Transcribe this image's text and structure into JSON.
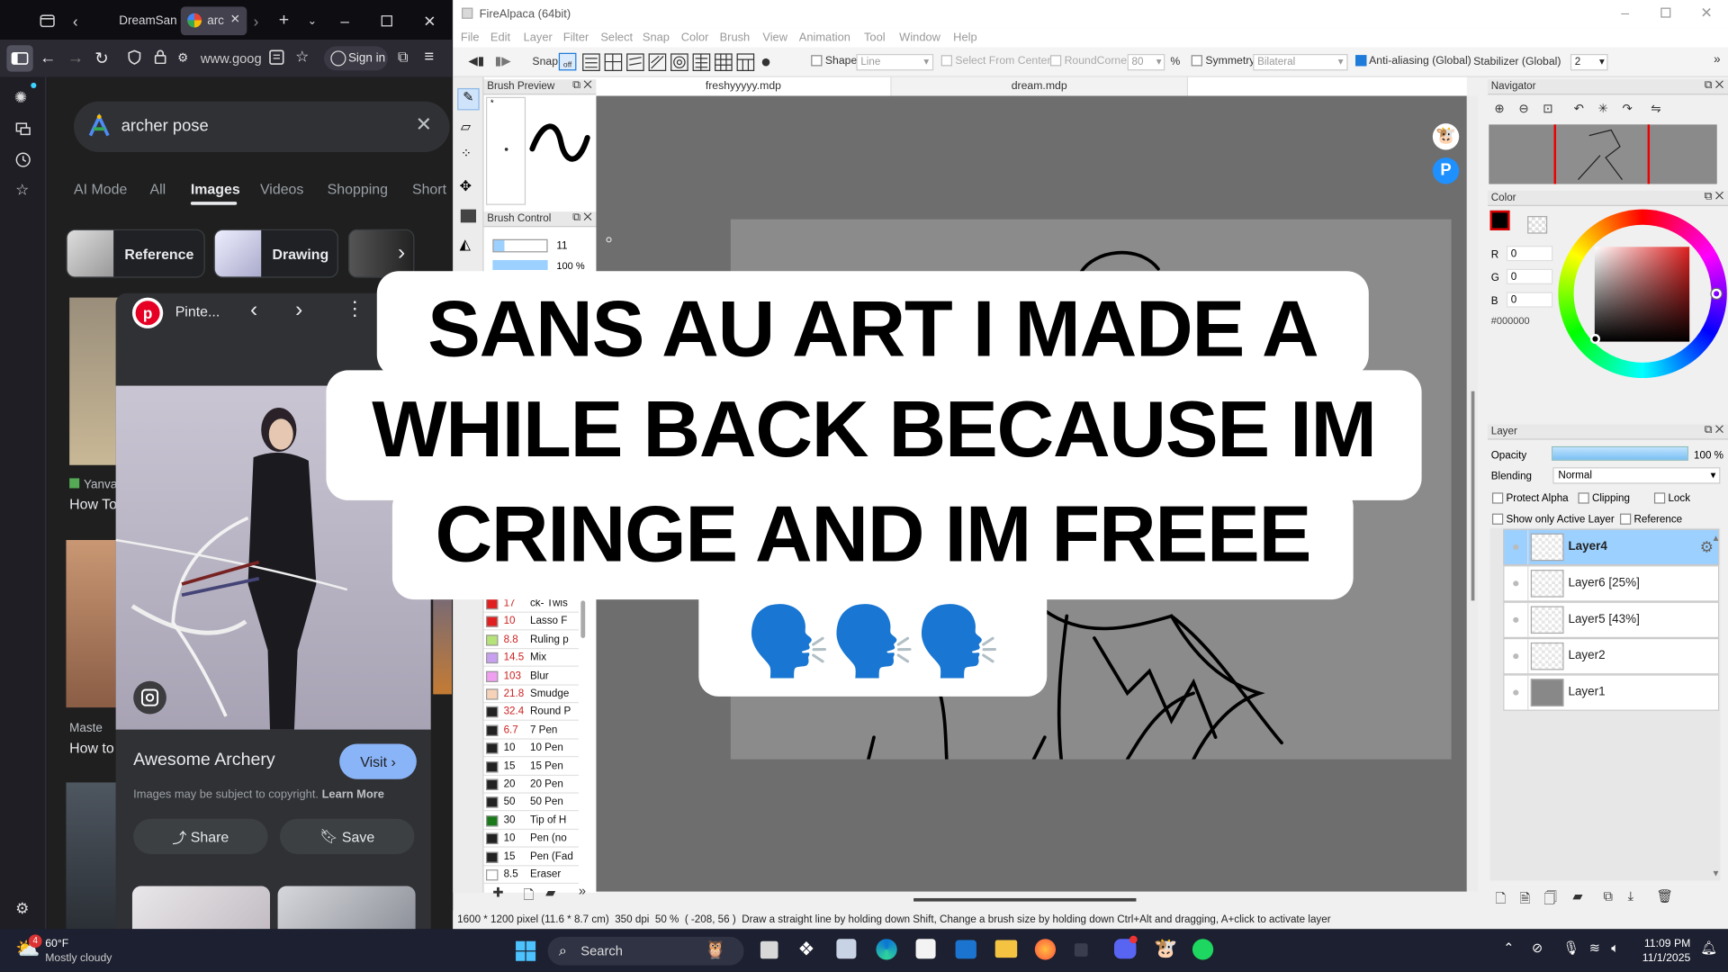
{
  "browser": {
    "tabs": [
      {
        "label": "DreamSan"
      },
      {
        "label": "arc"
      }
    ],
    "url": "www.goog",
    "sign_in": "Sign in",
    "search_query": "archer pose",
    "google_tabs": [
      "AI Mode",
      "All",
      "Images",
      "Videos",
      "Shopping",
      "Short"
    ],
    "chips": [
      "Reference",
      "Drawing"
    ],
    "bg_results": [
      {
        "source": "Yanva",
        "title": "How To"
      },
      {
        "source": "Maste",
        "title": "How to"
      }
    ],
    "pin": {
      "site": "Pinte...",
      "title": "Awesome Archery",
      "visit": "Visit",
      "copyright": "Images may be subject to copyright.",
      "learn_more": "Learn More",
      "share": "Share",
      "save": "Save"
    }
  },
  "firealpaca": {
    "window_title": "FireAlpaca (64bit)",
    "menu": [
      "File",
      "Edit",
      "Layer",
      "Filter",
      "Select",
      "Snap",
      "Color",
      "Brush",
      "View",
      "Animation",
      "Tool",
      "Window",
      "Help"
    ],
    "toolbar": {
      "snap": "Snap",
      "shape": "Shape",
      "shape_value": "Line",
      "select_from_center": "Select From Center",
      "round_corner": "RoundCorner",
      "round_corner_value": "80",
      "percent": "%",
      "symmetry": "Symmetry",
      "symmetry_value": "Bilateral",
      "anti_aliasing": "Anti-aliasing (Global)",
      "stabilizer": "Stabilizer (Global)",
      "stabilizer_value": "2"
    },
    "doc_tabs": [
      "freshyyyyy.mdp",
      "dream.mdp"
    ],
    "brush_preview_title": "Brush Preview",
    "brush_control_title": "Brush Control",
    "brush_control": {
      "size": "11",
      "opacity": "100 %"
    },
    "brushes": [
      {
        "size": "17",
        "name": "ck- Twis",
        "color": "#e02020"
      },
      {
        "size": "10",
        "name": "Lasso F",
        "color": "#e02020"
      },
      {
        "size": "8.8",
        "name": "Ruling p",
        "color": "#b6e27a"
      },
      {
        "size": "14.5",
        "name": "Mix",
        "color": "#c8a0f0"
      },
      {
        "size": "103",
        "name": "Blur",
        "color": "#f0a0f0"
      },
      {
        "size": "21.8",
        "name": "Smudge",
        "color": "#f6d2b8"
      },
      {
        "size": "32.4",
        "name": "Round P",
        "color": "#222222"
      },
      {
        "size": "6.7",
        "name": "7 Pen",
        "color": "#222222"
      },
      {
        "size": "10",
        "name": "10 Pen",
        "color": "#222222"
      },
      {
        "size": "15",
        "name": "15 Pen",
        "color": "#222222"
      },
      {
        "size": "20",
        "name": "20 Pen",
        "color": "#222222"
      },
      {
        "size": "50",
        "name": "50 Pen",
        "color": "#222222"
      },
      {
        "size": "30",
        "name": "Tip of H",
        "color": "#1a7a1a"
      },
      {
        "size": "10",
        "name": "Pen (no",
        "color": "#222222"
      },
      {
        "size": "15",
        "name": "Pen (Fad",
        "color": "#222222"
      },
      {
        "size": "8.5",
        "name": "Eraser",
        "color": "#ffffff"
      }
    ],
    "navigator_title": "Navigator",
    "color_title": "Color",
    "color": {
      "r": "0",
      "g": "0",
      "b": "0",
      "hex": "#000000",
      "r_label": "R",
      "g_label": "G",
      "b_label": "B"
    },
    "layer_title": "Layer",
    "layer_panel": {
      "opacity_label": "Opacity",
      "opacity": "100 %",
      "opacity_fraction": 1.0,
      "blending_label": "Blending",
      "blending": "Normal",
      "protect_alpha": "Protect Alpha",
      "clipping": "Clipping",
      "lock": "Lock",
      "show_only_active": "Show only Active Layer",
      "reference": "Reference"
    },
    "layers": [
      "Layer4",
      "Layer6 [25%]",
      "Layer5 [43%]",
      "Layer2",
      "Layer1"
    ],
    "status": {
      "size": "1600 * 1200 pixel",
      "cm": "(11.6 * 8.7 cm)",
      "dpi": "350 dpi",
      "zoom": "50 %",
      "coords": "( -208, 56 )",
      "hint": "Draw a straight line by holding down Shift, Change a brush size by holding down Ctrl+Alt and dragging, A+click to activate layer"
    }
  },
  "overlay": {
    "line1": "SANS AU ART I MADE A",
    "line2": "WHILE BACK BECAUSE IM",
    "line3": "CRINGE AND IM FREEE",
    "emoji": "🗣️🗣️🗣️"
  },
  "taskbar": {
    "temperature": "60°F",
    "weather": "Mostly cloudy",
    "weather_badge": "4",
    "search": "Search",
    "time": "11:09 PM",
    "date": "11/1/2025"
  },
  "colors": {
    "accent": "#1e7bd9",
    "layer_selected": "#9bd0ff",
    "google_visit": "#8ab4f8"
  }
}
